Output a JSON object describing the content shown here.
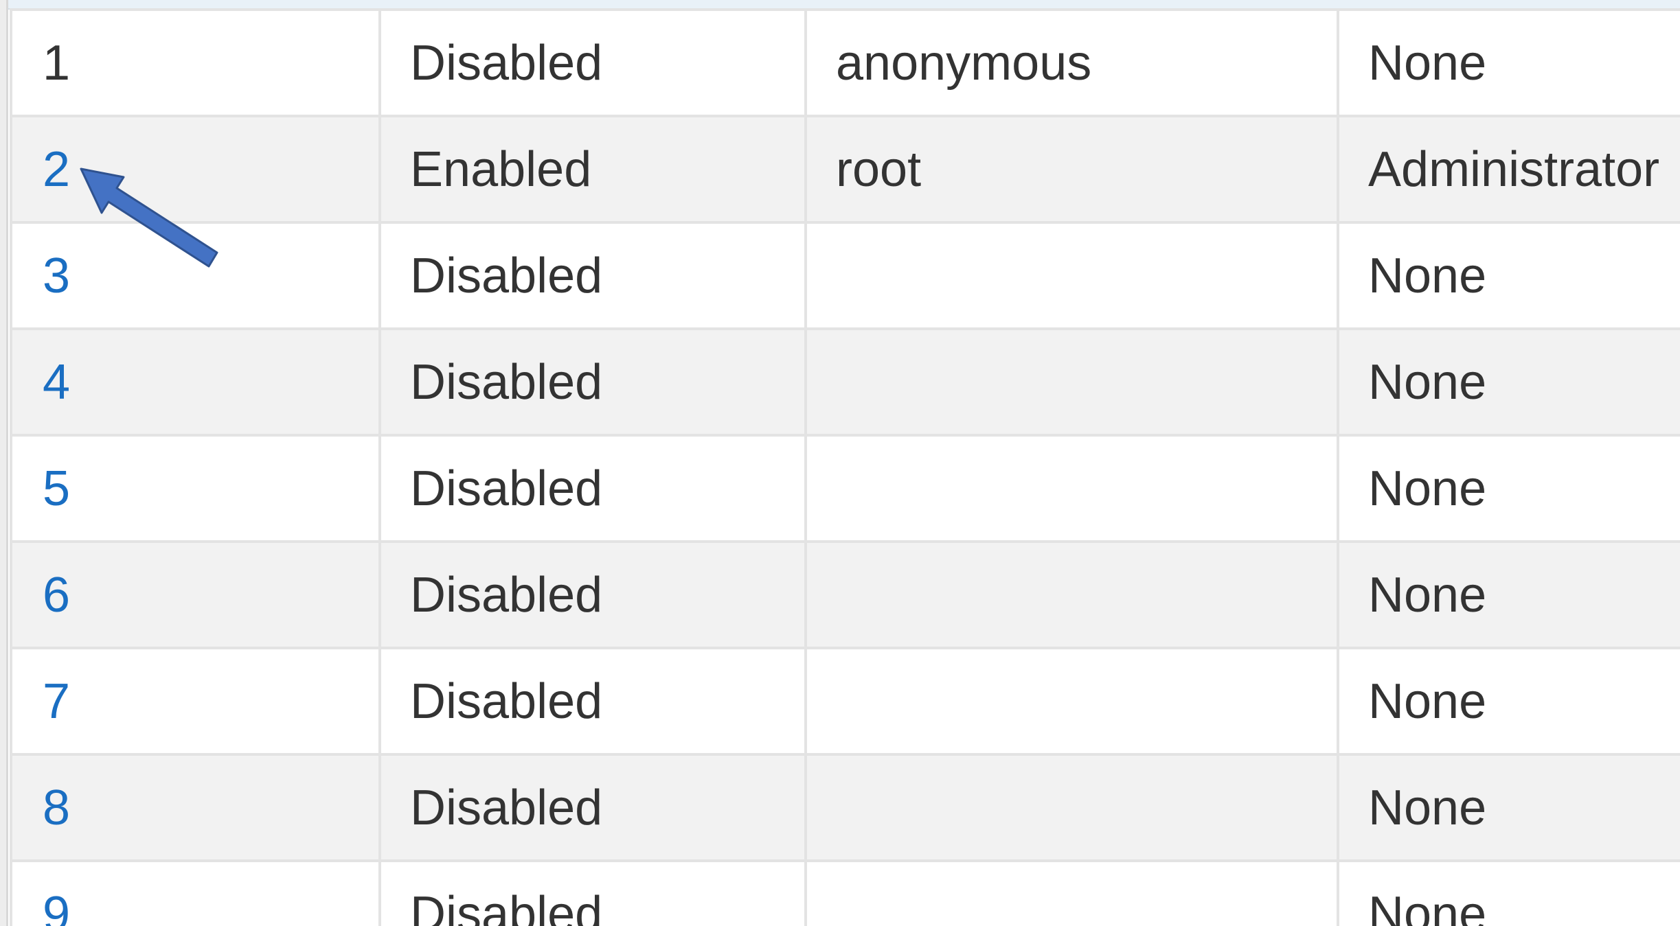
{
  "users_table": {
    "rows": [
      {
        "id": "1",
        "status": "Disabled",
        "username": "anonymous",
        "privilege": "None"
      },
      {
        "id": "2",
        "status": "Enabled",
        "username": "root",
        "privilege": "Administrator"
      },
      {
        "id": "3",
        "status": "Disabled",
        "username": "",
        "privilege": "None"
      },
      {
        "id": "4",
        "status": "Disabled",
        "username": "",
        "privilege": "None"
      },
      {
        "id": "5",
        "status": "Disabled",
        "username": "",
        "privilege": "None"
      },
      {
        "id": "6",
        "status": "Disabled",
        "username": "",
        "privilege": "None"
      },
      {
        "id": "7",
        "status": "Disabled",
        "username": "",
        "privilege": "None"
      },
      {
        "id": "8",
        "status": "Disabled",
        "username": "",
        "privilege": "None"
      },
      {
        "id": "9",
        "status": "Disabled",
        "username": "",
        "privilege": "None"
      }
    ]
  },
  "annotation": {
    "arrow_icon": "blue-arrow-pointing-up-left",
    "arrow_color": "#4472c4"
  },
  "colors": {
    "link": "#1a6ec2",
    "text": "#333333",
    "row_alt": "#f2f2f2",
    "border": "#e3e3e3"
  }
}
